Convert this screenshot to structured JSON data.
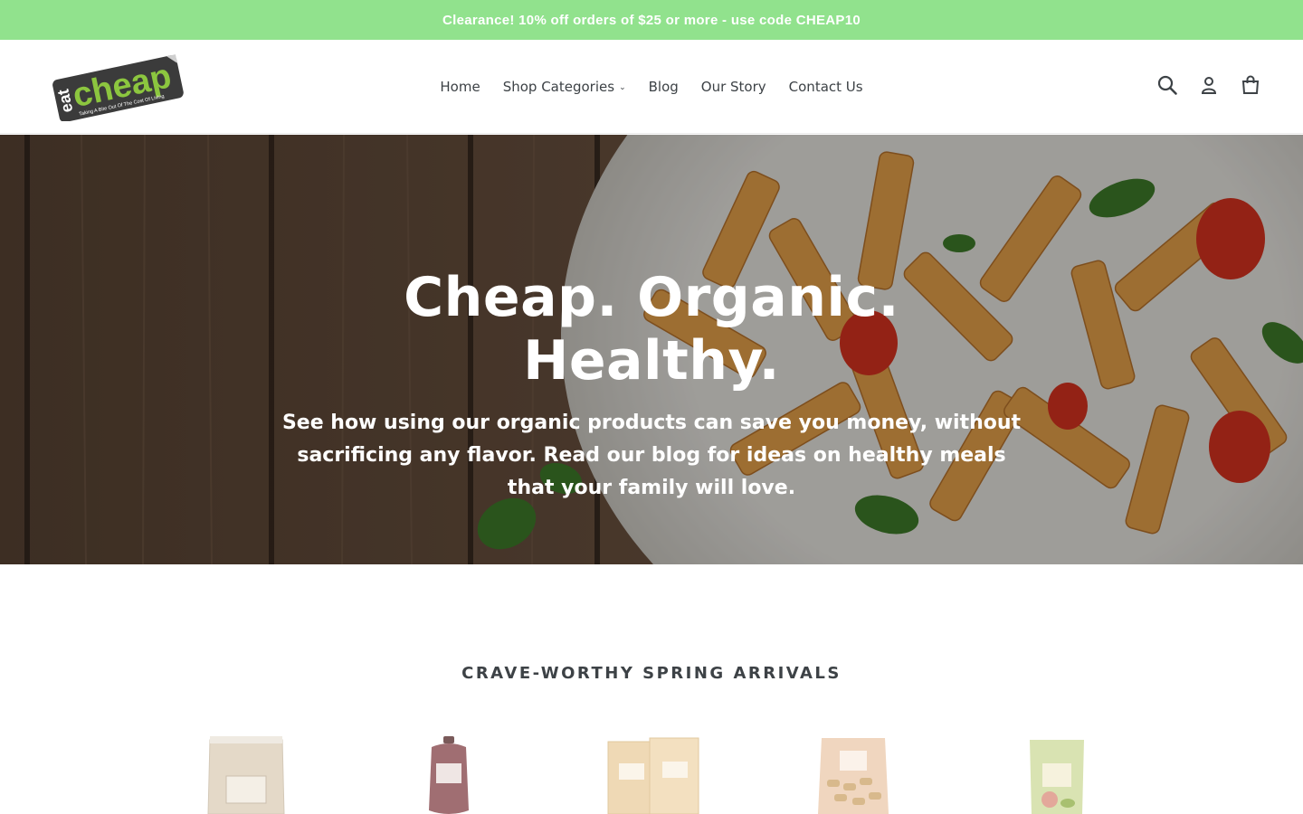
{
  "announcement": {
    "text": "Clearance! 10% off orders of $25 or more - use code CHEAP10"
  },
  "logo": {
    "word_eat": "eat",
    "word_cheap": "cheap",
    "tagline": "Taking A Bite Out Of The Cost Of Living"
  },
  "nav": {
    "items": [
      {
        "label": "Home"
      },
      {
        "label": "Shop Categories"
      },
      {
        "label": "Blog"
      },
      {
        "label": "Our Story"
      },
      {
        "label": "Contact Us"
      }
    ]
  },
  "header_icons": [
    "search-icon",
    "account-icon",
    "cart-icon"
  ],
  "hero": {
    "title": "Cheap. Organic. Healthy.",
    "subtitle": "See how using our organic products can save you money, without sacrificing any flavor. Read our blog for ideas on healthy meals that your family will love."
  },
  "featured": {
    "title": "CRAVE-WORTHY SPRING ARRIVALS",
    "products": [
      {
        "image": "garlic-salt-bag"
      },
      {
        "image": "ketchup-bottle"
      },
      {
        "image": "brown-rice-boxes"
      },
      {
        "image": "pasta-bag"
      },
      {
        "image": "green-pouch"
      }
    ]
  },
  "colors": {
    "announcement_bg": "#91e28d",
    "logo_green": "#8cc63f",
    "text": "#3d4246"
  }
}
